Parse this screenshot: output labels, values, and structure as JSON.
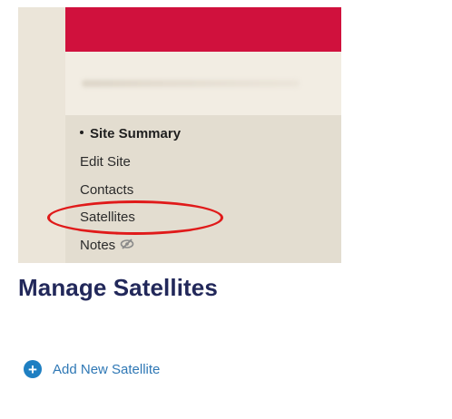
{
  "site_nav": {
    "items": [
      {
        "label": "Site Summary",
        "active": true
      },
      {
        "label": "Edit Site",
        "active": false
      },
      {
        "label": "Contacts",
        "active": false
      },
      {
        "label": "Satellites",
        "active": false,
        "highlighted": true
      },
      {
        "label": "Notes",
        "active": false,
        "icon": "eye-off-icon"
      }
    ]
  },
  "main": {
    "title": "Manage Satellites",
    "add_button": {
      "label": "Add New Satellite",
      "icon": "plus-circle-icon"
    }
  },
  "colors": {
    "banner": "#d0113d",
    "title": "#22285a",
    "link": "#2f78b5",
    "icon": "#1e7fc2",
    "highlight": "#e01a1a"
  }
}
